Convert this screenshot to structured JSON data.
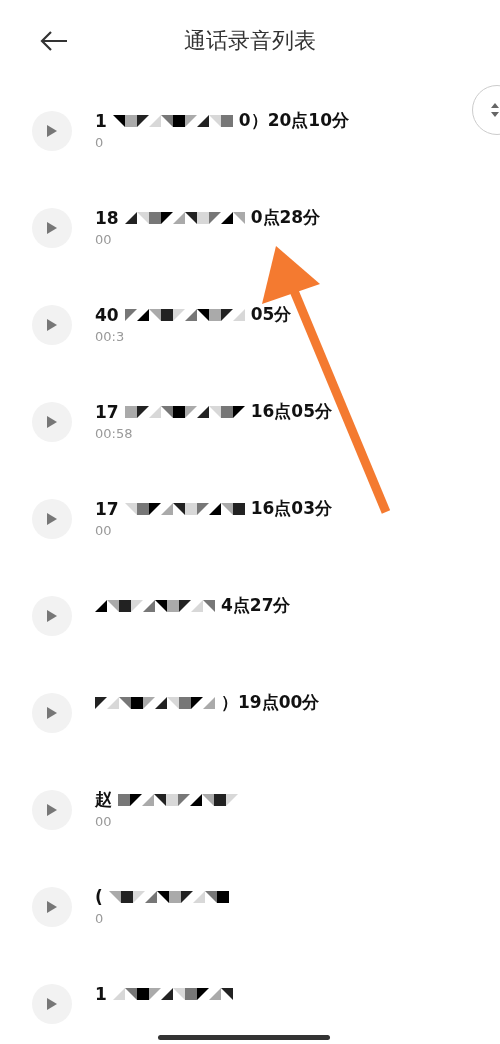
{
  "header": {
    "title": "通话录音列表"
  },
  "recordings": [
    {
      "title_start": "1",
      "title_end": "0）20点10分",
      "subtitle": "0"
    },
    {
      "title_start": "18",
      "title_end": "0点28分",
      "subtitle": "00"
    },
    {
      "title_start": "40",
      "title_end": "05分",
      "subtitle": "00:3"
    },
    {
      "title_start": "17",
      "title_end": "16点05分",
      "subtitle": "00:58"
    },
    {
      "title_start": "17",
      "title_end": "16点03分",
      "subtitle": "00"
    },
    {
      "title_end": "4点27分"
    },
    {
      "title_end": "）19点00分"
    },
    {
      "title_start": "赵",
      "subtitle": "00"
    },
    {
      "title_start": "(",
      "subtitle": "0"
    },
    {
      "title_start": "1"
    }
  ]
}
